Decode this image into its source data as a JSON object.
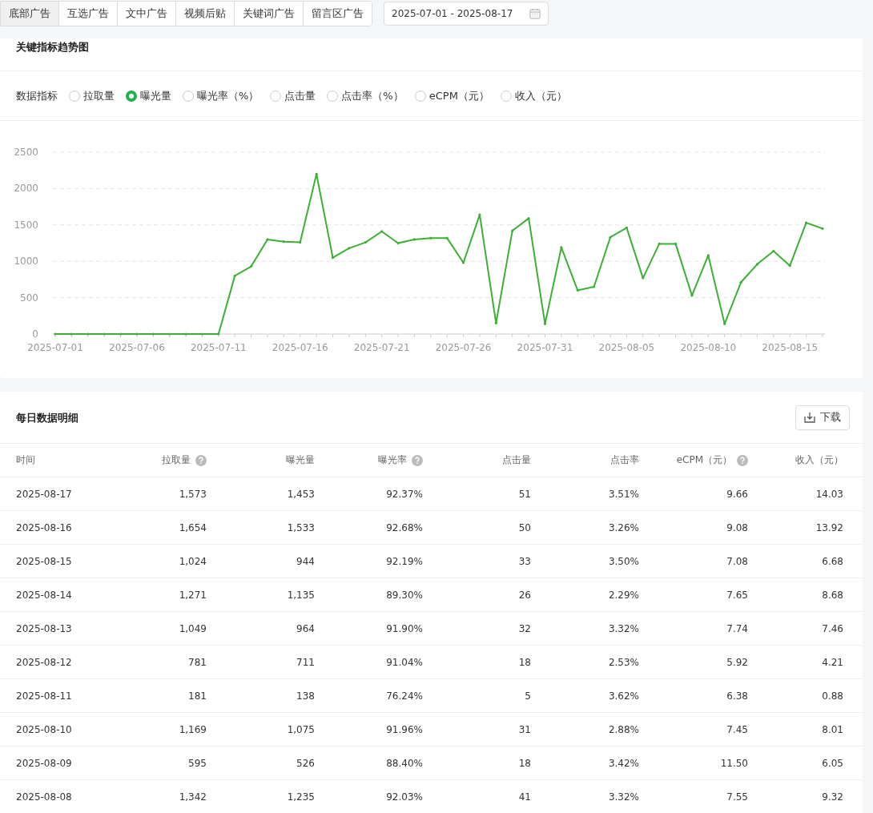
{
  "ad_tabs": [
    {
      "label": "底部广告",
      "selected": true
    },
    {
      "label": "互选广告",
      "selected": false
    },
    {
      "label": "文中广告",
      "selected": false
    },
    {
      "label": "视频后贴",
      "selected": false
    },
    {
      "label": "关键词广告",
      "selected": false
    },
    {
      "label": "留言区广告",
      "selected": false
    }
  ],
  "date_range": {
    "value": "2025-07-01 - 2025-08-17"
  },
  "trend_card": {
    "title": "关键指标趋势图",
    "metric_label": "数据指标",
    "metrics": [
      {
        "label": "拉取量",
        "selected": false
      },
      {
        "label": "曝光量",
        "selected": true
      },
      {
        "label": "曝光率（%）",
        "selected": false
      },
      {
        "label": "点击量",
        "selected": false
      },
      {
        "label": "点击率（%）",
        "selected": false
      },
      {
        "label": "eCPM（元）",
        "selected": false
      },
      {
        "label": "收入（元）",
        "selected": false
      }
    ],
    "chart_data": {
      "type": "line",
      "x": [
        "2025-07-01",
        "2025-07-02",
        "2025-07-03",
        "2025-07-04",
        "2025-07-05",
        "2025-07-06",
        "2025-07-07",
        "2025-07-08",
        "2025-07-09",
        "2025-07-10",
        "2025-07-11",
        "2025-07-12",
        "2025-07-13",
        "2025-07-14",
        "2025-07-15",
        "2025-07-16",
        "2025-07-17",
        "2025-07-18",
        "2025-07-19",
        "2025-07-20",
        "2025-07-21",
        "2025-07-22",
        "2025-07-23",
        "2025-07-24",
        "2025-07-25",
        "2025-07-26",
        "2025-07-27",
        "2025-07-28",
        "2025-07-29",
        "2025-07-30",
        "2025-07-31",
        "2025-08-01",
        "2025-08-02",
        "2025-08-03",
        "2025-08-04",
        "2025-08-05",
        "2025-08-06",
        "2025-08-07",
        "2025-08-08",
        "2025-08-09",
        "2025-08-10",
        "2025-08-11",
        "2025-08-12",
        "2025-08-13",
        "2025-08-14",
        "2025-08-15",
        "2025-08-16",
        "2025-08-17"
      ],
      "xticks": [
        "2025-07-01",
        "2025-07-06",
        "2025-07-11",
        "2025-07-16",
        "2025-07-21",
        "2025-07-26",
        "2025-07-31",
        "2025-08-05",
        "2025-08-10",
        "2025-08-15"
      ],
      "xlim": [
        "2025-07-01",
        "2025-08-17"
      ],
      "grid": true,
      "ylim": [
        0,
        2500
      ],
      "yticks": [
        0,
        500,
        1000,
        1500,
        2000,
        2500
      ],
      "series": [
        {
          "color": "#3cb034",
          "values": [
            0,
            0,
            0,
            0,
            0,
            0,
            0,
            0,
            0,
            0,
            0,
            800,
            930,
            1300,
            1270,
            1260,
            2200,
            1050,
            1180,
            1260,
            1410,
            1250,
            1300,
            1320,
            1320,
            980,
            1640,
            150,
            1420,
            1590,
            140,
            1190,
            600,
            650,
            1330,
            1460,
            770,
            1240,
            1240,
            530,
            1080,
            140,
            710,
            960,
            1140,
            940,
            1530,
            1450
          ]
        }
      ]
    }
  },
  "detail_card": {
    "title": "每日数据明细",
    "download_button": "下载",
    "columns": [
      {
        "label": "时间",
        "help": false
      },
      {
        "label": "拉取量",
        "help": true
      },
      {
        "label": "曝光量",
        "help": false
      },
      {
        "label": "曝光率",
        "help": true
      },
      {
        "label": "点击量",
        "help": false
      },
      {
        "label": "点击率",
        "help": false
      },
      {
        "label": "eCPM（元）",
        "help": true
      },
      {
        "label": "收入（元）",
        "help": false
      }
    ],
    "rows": [
      [
        "2025-08-17",
        "1,573",
        "1,453",
        "92.37%",
        "51",
        "3.51%",
        "9.66",
        "14.03"
      ],
      [
        "2025-08-16",
        "1,654",
        "1,533",
        "92.68%",
        "50",
        "3.26%",
        "9.08",
        "13.92"
      ],
      [
        "2025-08-15",
        "1,024",
        "944",
        "92.19%",
        "33",
        "3.50%",
        "7.08",
        "6.68"
      ],
      [
        "2025-08-14",
        "1,271",
        "1,135",
        "89.30%",
        "26",
        "2.29%",
        "7.65",
        "8.68"
      ],
      [
        "2025-08-13",
        "1,049",
        "964",
        "91.90%",
        "32",
        "3.32%",
        "7.74",
        "7.46"
      ],
      [
        "2025-08-12",
        "781",
        "711",
        "91.04%",
        "18",
        "2.53%",
        "5.92",
        "4.21"
      ],
      [
        "2025-08-11",
        "181",
        "138",
        "76.24%",
        "5",
        "3.62%",
        "6.38",
        "0.88"
      ],
      [
        "2025-08-10",
        "1,169",
        "1,075",
        "91.96%",
        "31",
        "2.88%",
        "7.45",
        "8.01"
      ],
      [
        "2025-08-09",
        "595",
        "526",
        "88.40%",
        "18",
        "3.42%",
        "11.50",
        "6.05"
      ],
      [
        "2025-08-08",
        "1,342",
        "1,235",
        "92.03%",
        "41",
        "3.32%",
        "7.55",
        "9.32"
      ]
    ]
  }
}
